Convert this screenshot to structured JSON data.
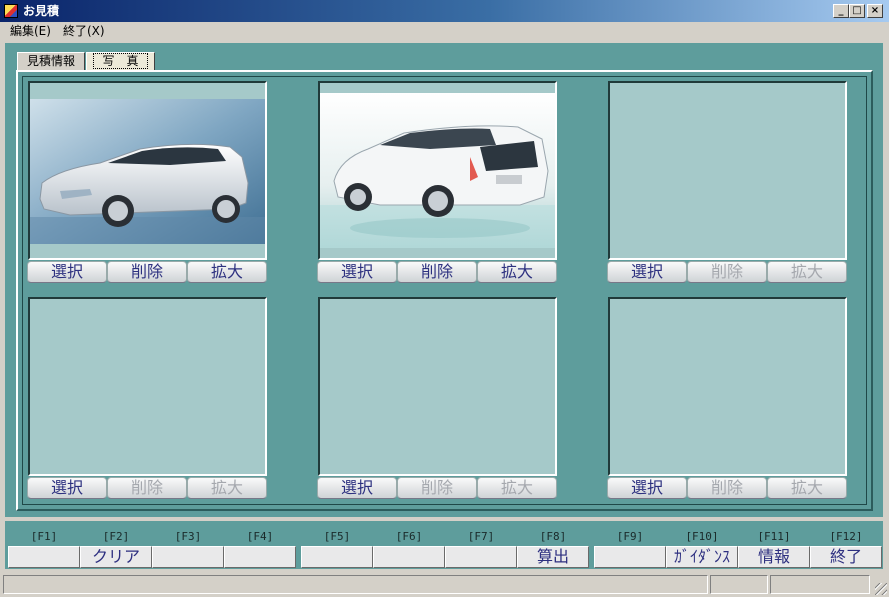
{
  "window": {
    "title": "お見積",
    "minimize": "_",
    "maximize": "□",
    "close": "×"
  },
  "menu": {
    "items": [
      "編集(E)",
      "終了(X)"
    ]
  },
  "tabs": [
    {
      "label": "見積情報",
      "active": false
    },
    {
      "label": "写　真",
      "active": true
    }
  ],
  "photos": [
    {
      "has_image": true,
      "select": "選択",
      "delete": "削除",
      "enlarge": "拡大",
      "delete_enabled": true,
      "enlarge_enabled": true
    },
    {
      "has_image": true,
      "select": "選択",
      "delete": "削除",
      "enlarge": "拡大",
      "delete_enabled": true,
      "enlarge_enabled": true
    },
    {
      "has_image": false,
      "select": "選択",
      "delete": "削除",
      "enlarge": "拡大",
      "delete_enabled": false,
      "enlarge_enabled": false
    },
    {
      "has_image": false,
      "select": "選択",
      "delete": "削除",
      "enlarge": "拡大",
      "delete_enabled": false,
      "enlarge_enabled": false
    },
    {
      "has_image": false,
      "select": "選択",
      "delete": "削除",
      "enlarge": "拡大",
      "delete_enabled": false,
      "enlarge_enabled": false
    },
    {
      "has_image": false,
      "select": "選択",
      "delete": "削除",
      "enlarge": "拡大",
      "delete_enabled": false,
      "enlarge_enabled": false
    }
  ],
  "function_keys": [
    {
      "key": "[F1]",
      "label": ""
    },
    {
      "key": "[F2]",
      "label": "クリア"
    },
    {
      "key": "[F3]",
      "label": ""
    },
    {
      "key": "[F4]",
      "label": ""
    },
    {
      "key": "[F5]",
      "label": ""
    },
    {
      "key": "[F6]",
      "label": ""
    },
    {
      "key": "[F7]",
      "label": ""
    },
    {
      "key": "[F8]",
      "label": "算出"
    },
    {
      "key": "[F9]",
      "label": ""
    },
    {
      "key": "[F10]",
      "label": "ｶﾞｲﾀﾞﾝｽ"
    },
    {
      "key": "[F11]",
      "label": "情報"
    },
    {
      "key": "[F12]",
      "label": "終了"
    }
  ],
  "colors": {
    "background": "#5e9d9c",
    "photo_empty": "#a5c9c9",
    "button_text": "#2d3180",
    "button_text_disabled": "#a5a8ae"
  }
}
